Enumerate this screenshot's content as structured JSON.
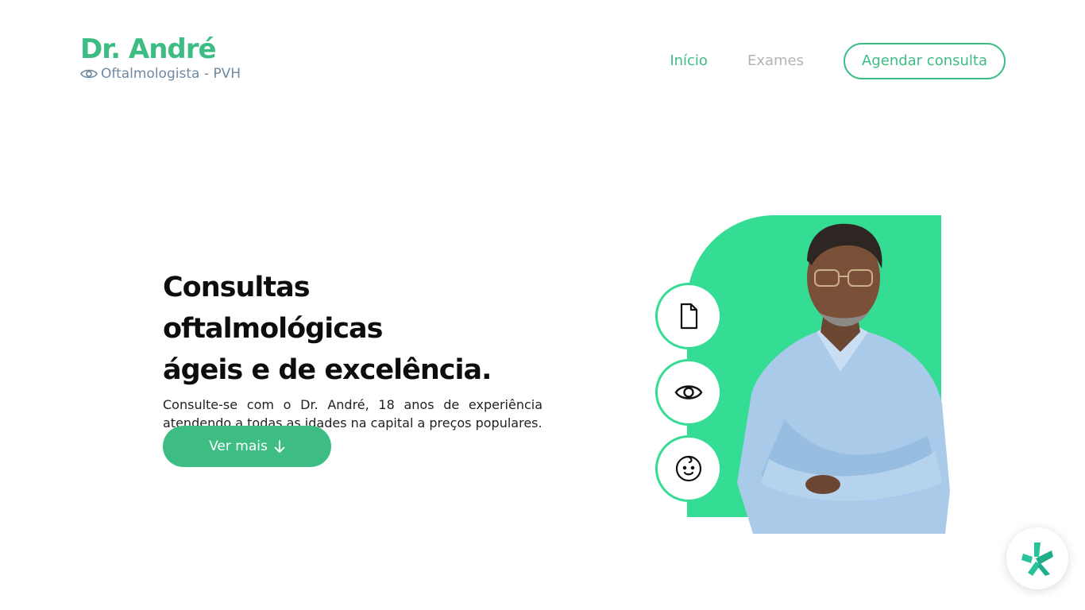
{
  "header": {
    "brand_name": "Dr. André",
    "brand_subtitle": "Oftalmologista - PVH",
    "brand_icon": "eye-icon",
    "nav": {
      "inicio": "Início",
      "exames": "Exames",
      "cta": "Agendar consulta"
    }
  },
  "hero": {
    "title_line1": "Consultas oftalmológicas",
    "title_line2": "ágeis e de excelência.",
    "description": "Consulte-se com o Dr. André, 18 anos de experiência atendendo a todas as idades na capital a preços populares.",
    "button_label": "Ver mais",
    "button_icon": "arrow-down-icon"
  },
  "feature_icons": [
    "document-icon",
    "eye-icon",
    "baby-face-icon"
  ],
  "widget_icon": "doctoralia-icon",
  "colors": {
    "accent": "#3dbd83",
    "shape_green": "#35dc93",
    "subtitle": "#6f8aa2",
    "nav_inactive": "#b3b3b3"
  }
}
